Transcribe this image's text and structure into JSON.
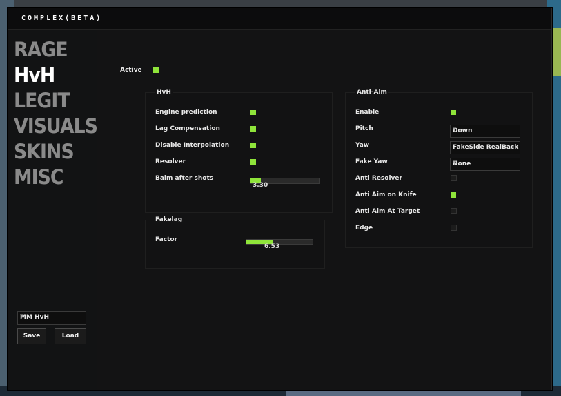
{
  "window": {
    "title": "COMPLEX(BETA)"
  },
  "nav": {
    "items": [
      {
        "label": "RAGE",
        "active": false
      },
      {
        "label": "HvH",
        "active": true
      },
      {
        "label": "LEGIT",
        "active": false
      },
      {
        "label": "VISUALS",
        "active": false
      },
      {
        "label": "SKINS",
        "active": false
      },
      {
        "label": "MISC",
        "active": false
      }
    ],
    "config": {
      "selected": "MM HvH"
    },
    "save_label": "Save",
    "load_label": "Load"
  },
  "main": {
    "active_label": "Active",
    "active_checked": true,
    "hvh": {
      "title": "HvH",
      "engine_prediction": "Engine prediction",
      "lag_compensation": "Lag Compensation",
      "disable_interpolation": "Disable Interpolation",
      "resolver": "Resolver",
      "baim_after_shots": "Baim after shots",
      "baim_value": "3.30",
      "baim_fill": 0.15
    },
    "fakelag": {
      "title": "Fakelag",
      "factor": "Factor",
      "factor_value": "6.53",
      "factor_fill": 0.4
    },
    "antiaim": {
      "title": "Anti-Aim",
      "enable": "Enable",
      "pitch": "Pitch",
      "pitch_value": "Down",
      "yaw": "Yaw",
      "yaw_value": "FakeSide RealBack",
      "fake_yaw": "Fake Yaw",
      "fake_yaw_value": "None",
      "anti_resolver": "Anti Resolver",
      "anti_aim_knife": "Anti Aim on Knife",
      "anti_aim_target": "Anti Aim At Target",
      "edge": "Edge"
    }
  },
  "colors": {
    "accent": "#8fe43a",
    "background": "#111214"
  }
}
